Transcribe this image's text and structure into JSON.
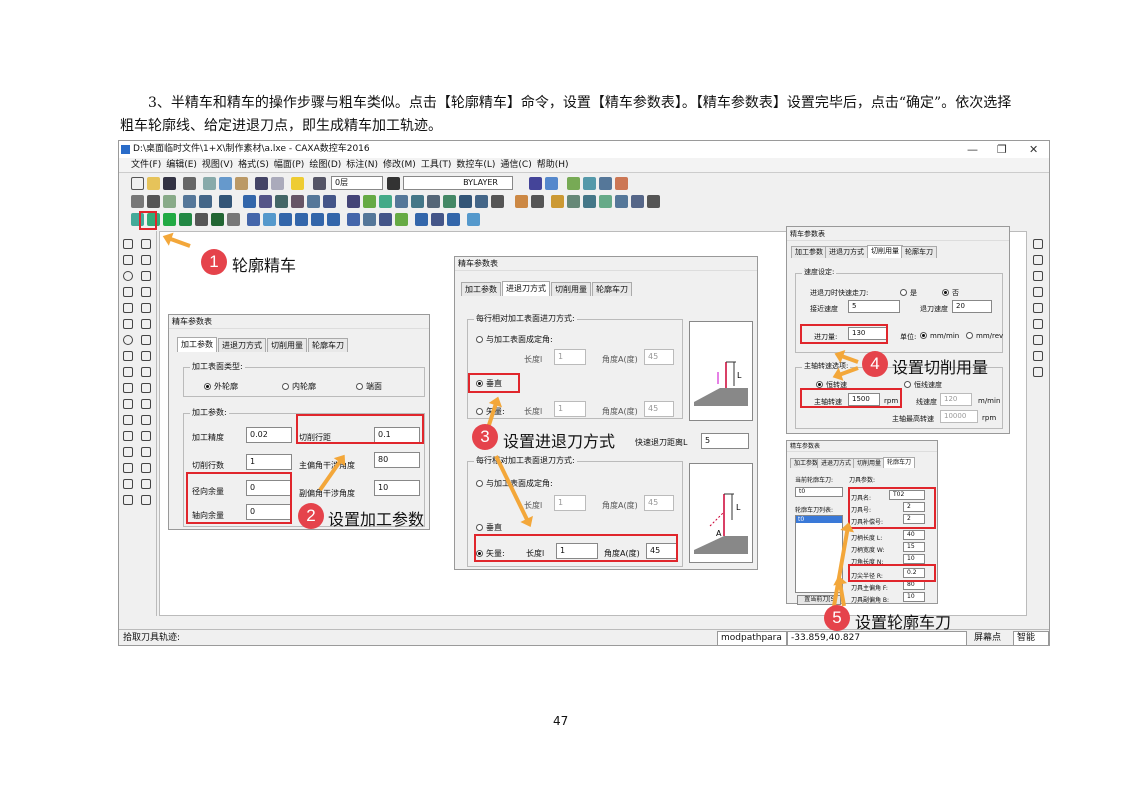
{
  "paragraph": "3、半精车和精车的操作步骤与粗车类似。点击【轮廓精车】命令，设置【精车参数表】。【精车参数表】设置完毕后，点击“确定”。依次选择粗车轮廓线、给定进退刀点，即生成精车加工轨迹。",
  "page_number": "47",
  "window": {
    "title": "D:\\桌面临时文件\\1+X\\制作素材\\a.lxe - CAXA数控车2016",
    "minimize": "—",
    "restore": "❐",
    "close": "✕",
    "menu": [
      "文件(F)",
      "编辑(E)",
      "视图(V)",
      "格式(S)",
      "幅面(P)",
      "绘图(D)",
      "标注(N)",
      "修改(M)",
      "工具(T)",
      "数控车(L)",
      "通信(C)",
      "帮助(H)"
    ],
    "layer_value": "0层",
    "linetype_value": "BYLAYER",
    "status_prompt": "拾取刀具轨迹:",
    "status_cmd": "modpathpara",
    "status_coords": "-33.859,40.827",
    "status_snap_label": "屏幕点",
    "status_mode": "智能"
  },
  "callouts": [
    {
      "num": "1",
      "text": "轮廓精车"
    },
    {
      "num": "2",
      "text": "设置加工参数"
    },
    {
      "num": "3",
      "text": "设置进退刀方式"
    },
    {
      "num": "4",
      "text": "设置切削用量"
    },
    {
      "num": "5",
      "text": "设置轮廓车刀"
    }
  ],
  "dlg1": {
    "title": "精车参数表",
    "tabs": [
      "加工参数",
      "进退刀方式",
      "切削用量",
      "轮廓车刀"
    ],
    "surface_group": "加工表面类型:",
    "surface_options": [
      "外轮廓",
      "内轮廓",
      "端面"
    ],
    "param_group": "加工参数:",
    "precision_label": "加工精度",
    "precision_value": "0.02",
    "step_label": "切削行距",
    "step_value": "0.1",
    "rows_label": "切削行数",
    "rows_value": "1",
    "main_angle_label": "主偏角干涉角度",
    "main_angle_value": "80",
    "radial_label": "径向余量",
    "radial_value": "0",
    "aux_angle_label": "副偏角干涉角度",
    "aux_angle_value": "10",
    "axial_label": "轴向余量",
    "axial_value": "0"
  },
  "dlg2": {
    "title": "精车参数表",
    "tabs": [
      "加工参数",
      "进退刀方式",
      "切削用量",
      "轮廓车刀"
    ],
    "enter_group": "每行相对加工表面进刀方式:",
    "exit_group": "每行相对加工表面退刀方式:",
    "opt_angle": "与加工表面成定角:",
    "opt_vertical": "垂直",
    "opt_vector": "矢量:",
    "length_label": "长度l",
    "angle_label": "角度A(度)",
    "enter_len1": "1",
    "enter_ang1": "45",
    "enter_len2": "1",
    "enter_ang2": "45",
    "exit_len1": "1",
    "exit_ang1": "45",
    "exit_len2": "1",
    "exit_ang2": "45",
    "quick_label": "快速退刀距离L",
    "quick_value": "5",
    "pic_label_l": "L",
    "pic_label_a": "A"
  },
  "dlg3": {
    "title": "精车参数表",
    "tabs": [
      "加工参数",
      "进退刀方式",
      "切削用量",
      "轮廓车刀"
    ],
    "speed_group": "速度设定:",
    "rapid_label": "进退刀时快速走刀:",
    "yes": "是",
    "no": "否",
    "approach_label": "接近速度",
    "approach_value": "5",
    "retract_label": "退刀速度",
    "retract_value": "20",
    "feed_label": "进刀量:",
    "feed_value": "130",
    "unit_label": "单位:",
    "unit1": "mm/min",
    "unit2": "mm/rev",
    "spindle_group": "主轴转速选项:",
    "const_speed": "恒转速",
    "linear_speed": "恒线速度",
    "spindle_label": "主轴转速",
    "spindle_value": "1500",
    "spindle_unit": "rpm",
    "linear_label": "线速度",
    "linear_value": "120",
    "linear_unit": "m/min",
    "max_label": "主轴最高转速",
    "max_value": "10000",
    "max_unit": "rpm"
  },
  "dlg4": {
    "title": "精车参数表",
    "tabs": [
      "加工参数",
      "进退刀方式",
      "切削用量",
      "轮廓车刀"
    ],
    "current_label": "当前轮廓车刀:",
    "current_value": "t0",
    "tool_params_label": "刀具参数:",
    "list_label": "轮廓车刀列表:",
    "list_item": "t0",
    "tool_name_label": "刀具名:",
    "tool_name": "T02",
    "tool_no_label": "刀具号:",
    "tool_no": "2",
    "comp_label": "刀具补偿号:",
    "comp": "2",
    "handle_len_label": "刀柄长度 L:",
    "handle_len": "40",
    "handle_w_label": "刀柄宽度 W:",
    "handle_w": "15",
    "blade_len_label": "刀角长度 N:",
    "blade_len": "10",
    "radius_label": "刀尖半径 R:",
    "radius": "0.2",
    "main_angle_label": "刀具主偏角 F:",
    "main_angle": "80",
    "aux_angle_label": "刀具副偏角 B:",
    "aux_angle": "10",
    "set_current_btn": "置当前刀[S]"
  }
}
